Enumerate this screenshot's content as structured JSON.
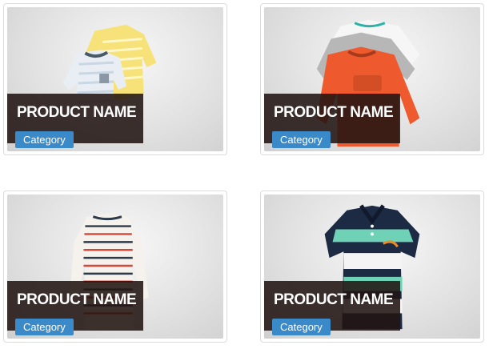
{
  "products": [
    {
      "name": "PRODUCT NAME",
      "category": "Category",
      "image_icon": "baby-bodysuits-icon"
    },
    {
      "name": "PRODUCT NAME",
      "category": "Category",
      "image_icon": "long-sleeve-shirts-icon"
    },
    {
      "name": "PRODUCT NAME",
      "category": "Category",
      "image_icon": "striped-top-icon"
    },
    {
      "name": "PRODUCT NAME",
      "category": "Category",
      "image_icon": "polo-shirt-icon"
    }
  ],
  "colors": {
    "overlay": "#221412",
    "badge": "#3a8ac9"
  }
}
